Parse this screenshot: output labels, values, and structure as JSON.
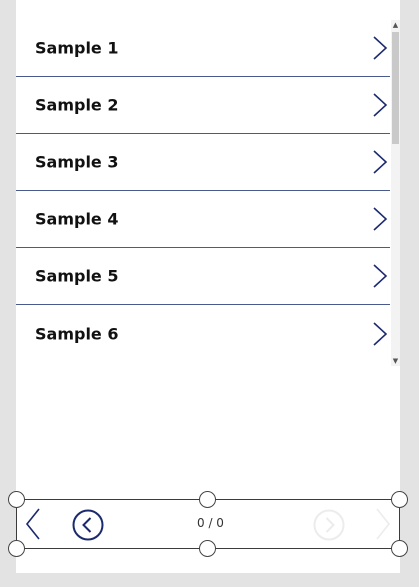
{
  "gallery": {
    "items": [
      {
        "label": "Sample 1"
      },
      {
        "label": "Sample 2"
      },
      {
        "label": "Sample 3"
      },
      {
        "label": "Sample 4"
      },
      {
        "label": "Sample 5"
      },
      {
        "label": "Sample 6"
      }
    ],
    "chevron_icon": "chevron-right-icon",
    "divider_color": "#4a5a8c",
    "chevron_color": "#1b2a6e"
  },
  "pager": {
    "page_indicator": "0 / 0",
    "icons": [
      "chevron-left-icon",
      "circle-chevron-left-icon",
      "circle-chevron-right-icon",
      "chevron-right-icon"
    ],
    "accent_color": "#1b2a6e"
  }
}
